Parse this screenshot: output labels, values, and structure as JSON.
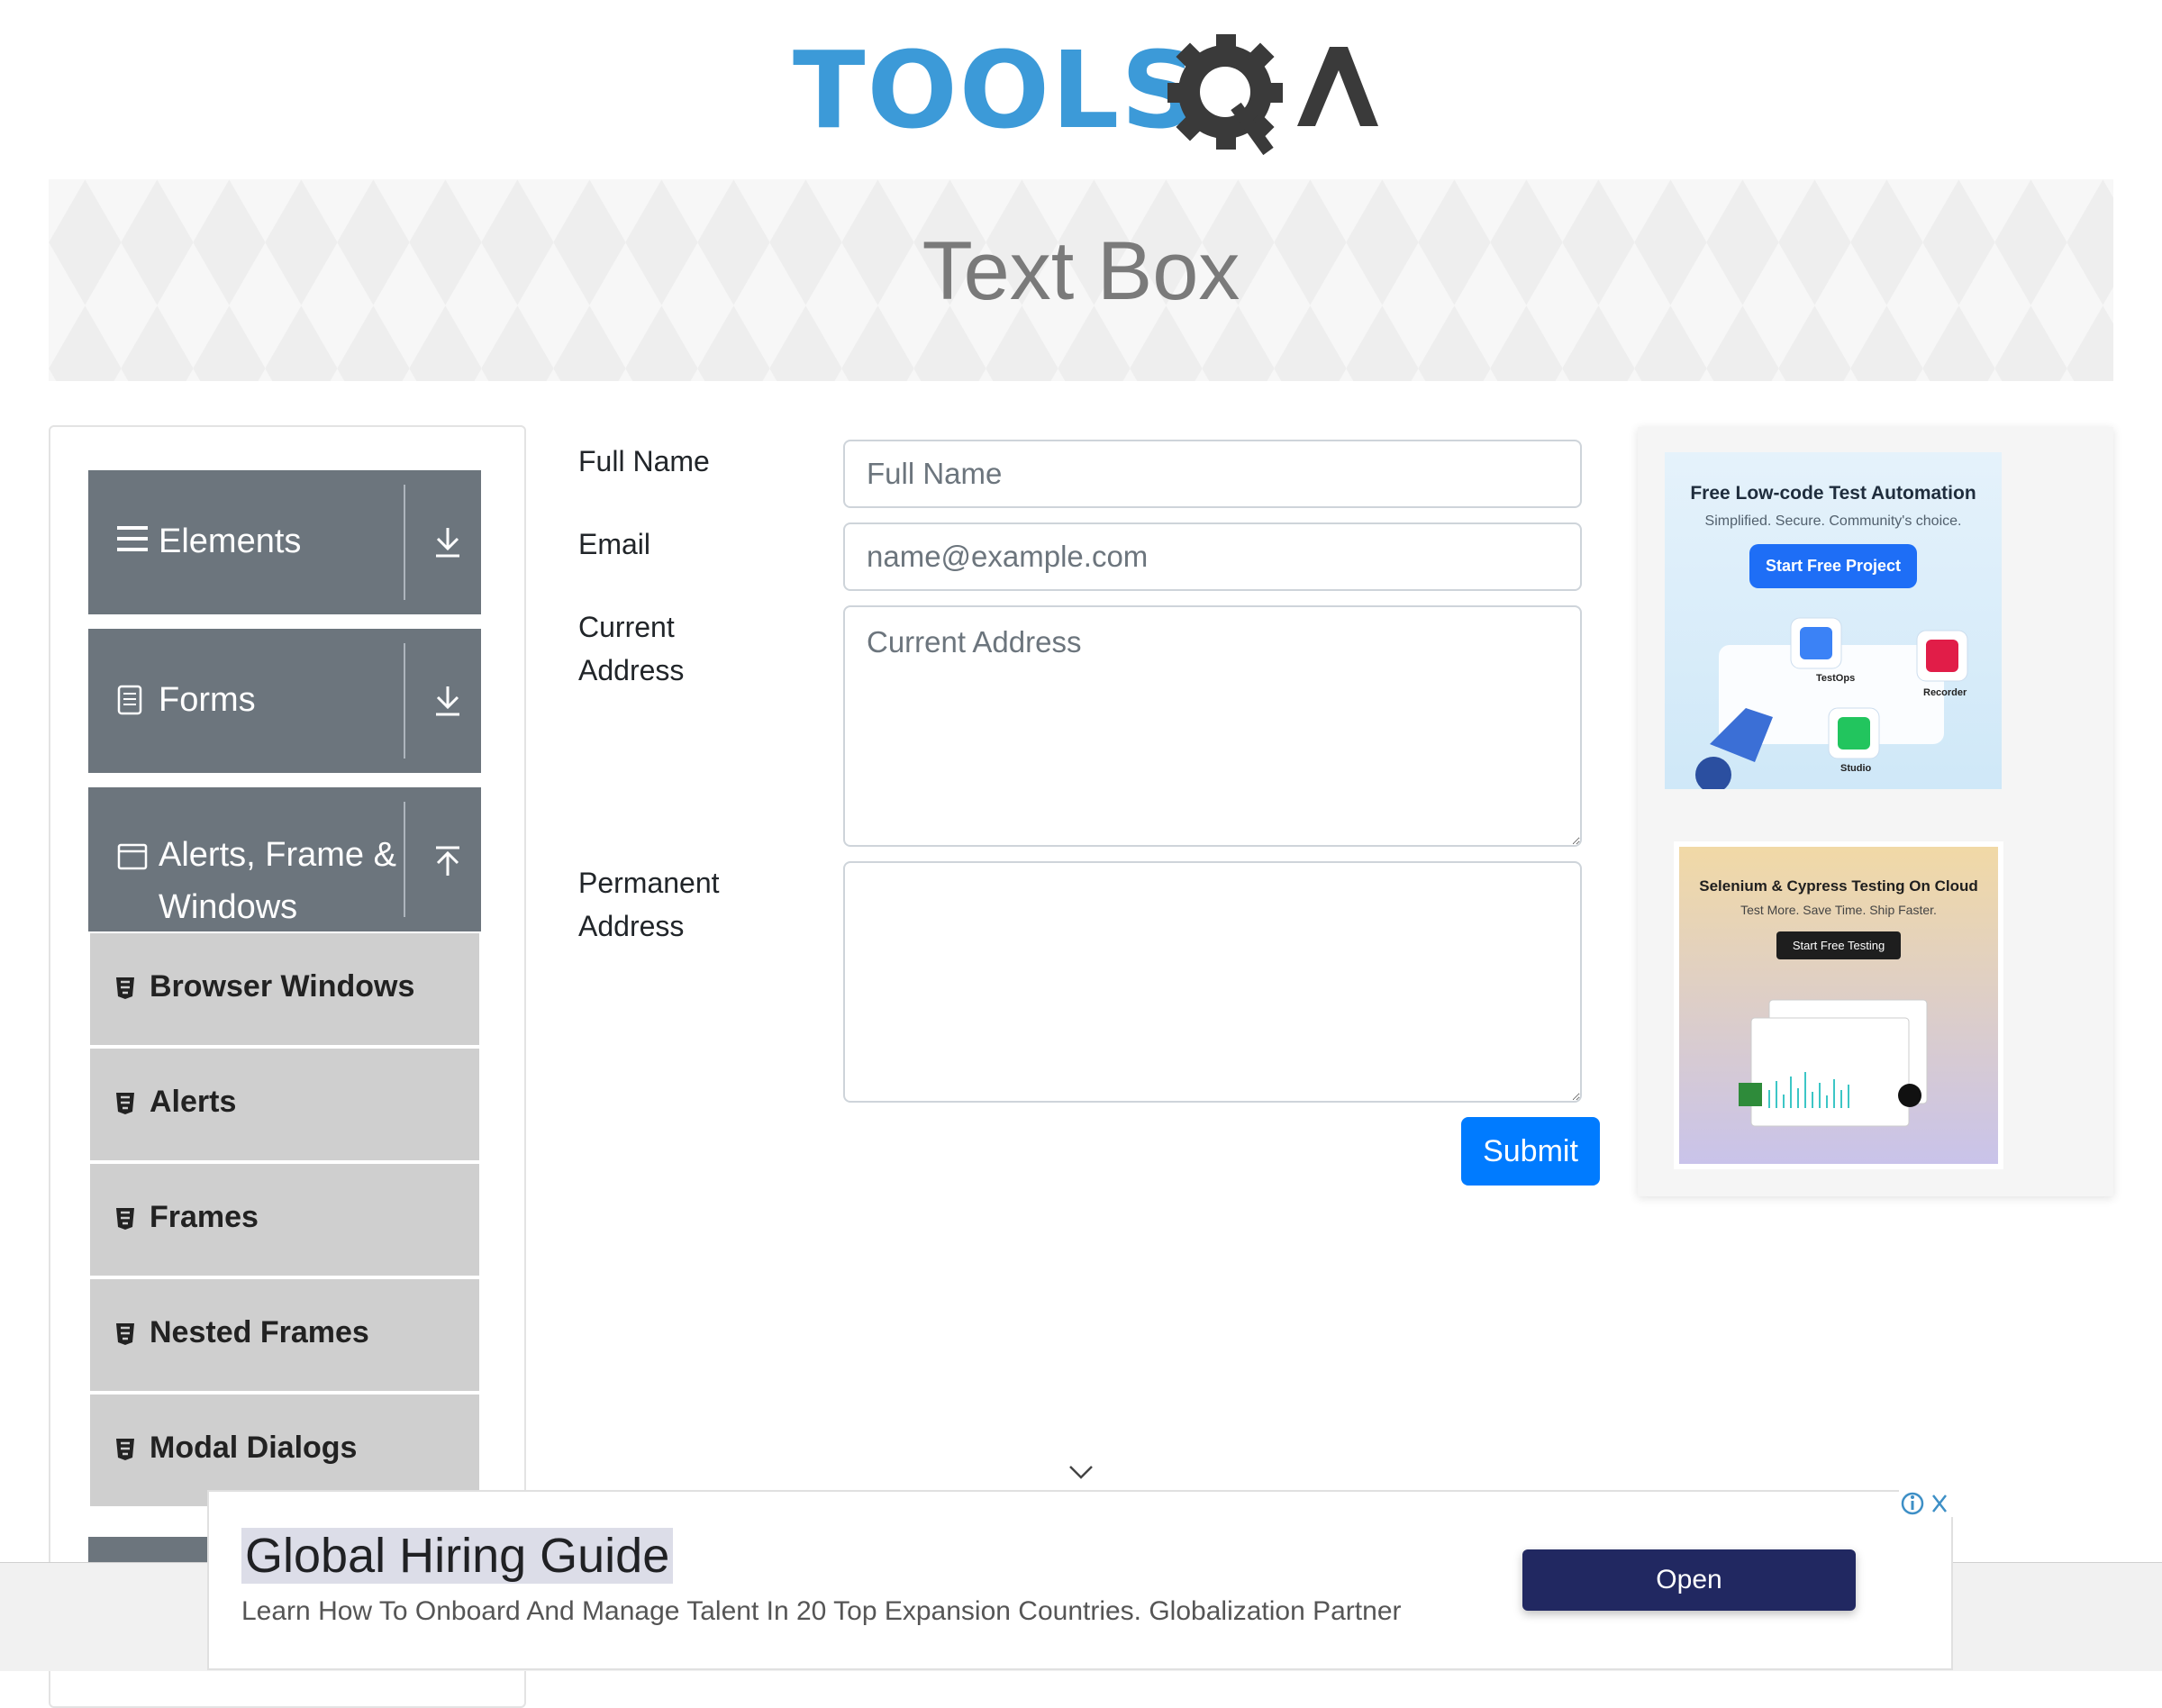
{
  "header": {
    "logo_text": "TOOLS",
    "logo_suffix": "A"
  },
  "page": {
    "title": "Text Box"
  },
  "sidebar": {
    "groups": [
      {
        "label": "Elements",
        "icon": "hamburger-icon",
        "arrow": "download-arrow-icon"
      },
      {
        "label": "Forms",
        "icon": "document-icon",
        "arrow": "download-arrow-icon"
      },
      {
        "label": "Alerts, Frame & Windows",
        "icon": "window-icon",
        "arrow": "upload-arrow-icon"
      }
    ],
    "items": [
      {
        "label": "Browser Windows"
      },
      {
        "label": "Alerts"
      },
      {
        "label": "Frames"
      },
      {
        "label": "Nested Frames"
      },
      {
        "label": "Modal Dialogs"
      }
    ]
  },
  "form": {
    "full_name_label": "Full Name",
    "full_name_placeholder": "Full Name",
    "email_label": "Email",
    "email_placeholder": "name@example.com",
    "current_address_label": "Current Address",
    "current_address_placeholder": "Current Address",
    "permanent_address_label": "Permanent Address",
    "permanent_address_value": "",
    "submit_label": "Submit"
  },
  "ads": {
    "ad1": {
      "title": "Free Low-code Test Automation",
      "subtitle": "Simplified. Secure. Community's choice.",
      "button": "Start Free Project",
      "tiles": [
        "TestOps",
        "Recorder",
        "Studio"
      ]
    },
    "ad2": {
      "title": "Selenium & Cypress Testing On Cloud",
      "subtitle": "Test More. Save Time. Ship Faster.",
      "button": "Start Free Testing"
    }
  },
  "bottom_ad": {
    "title": "Global Hiring Guide",
    "description": "Learn How To Onboard And Manage Talent In 20 Top Expansion Countries. Globalization Partner",
    "button": "Open"
  },
  "colors": {
    "sidebar_group": "#6c757d",
    "sidebar_item": "#cfcfcf",
    "submit": "#007bff",
    "logo_blue": "#3c9ad8",
    "ad_button": "#212861"
  }
}
